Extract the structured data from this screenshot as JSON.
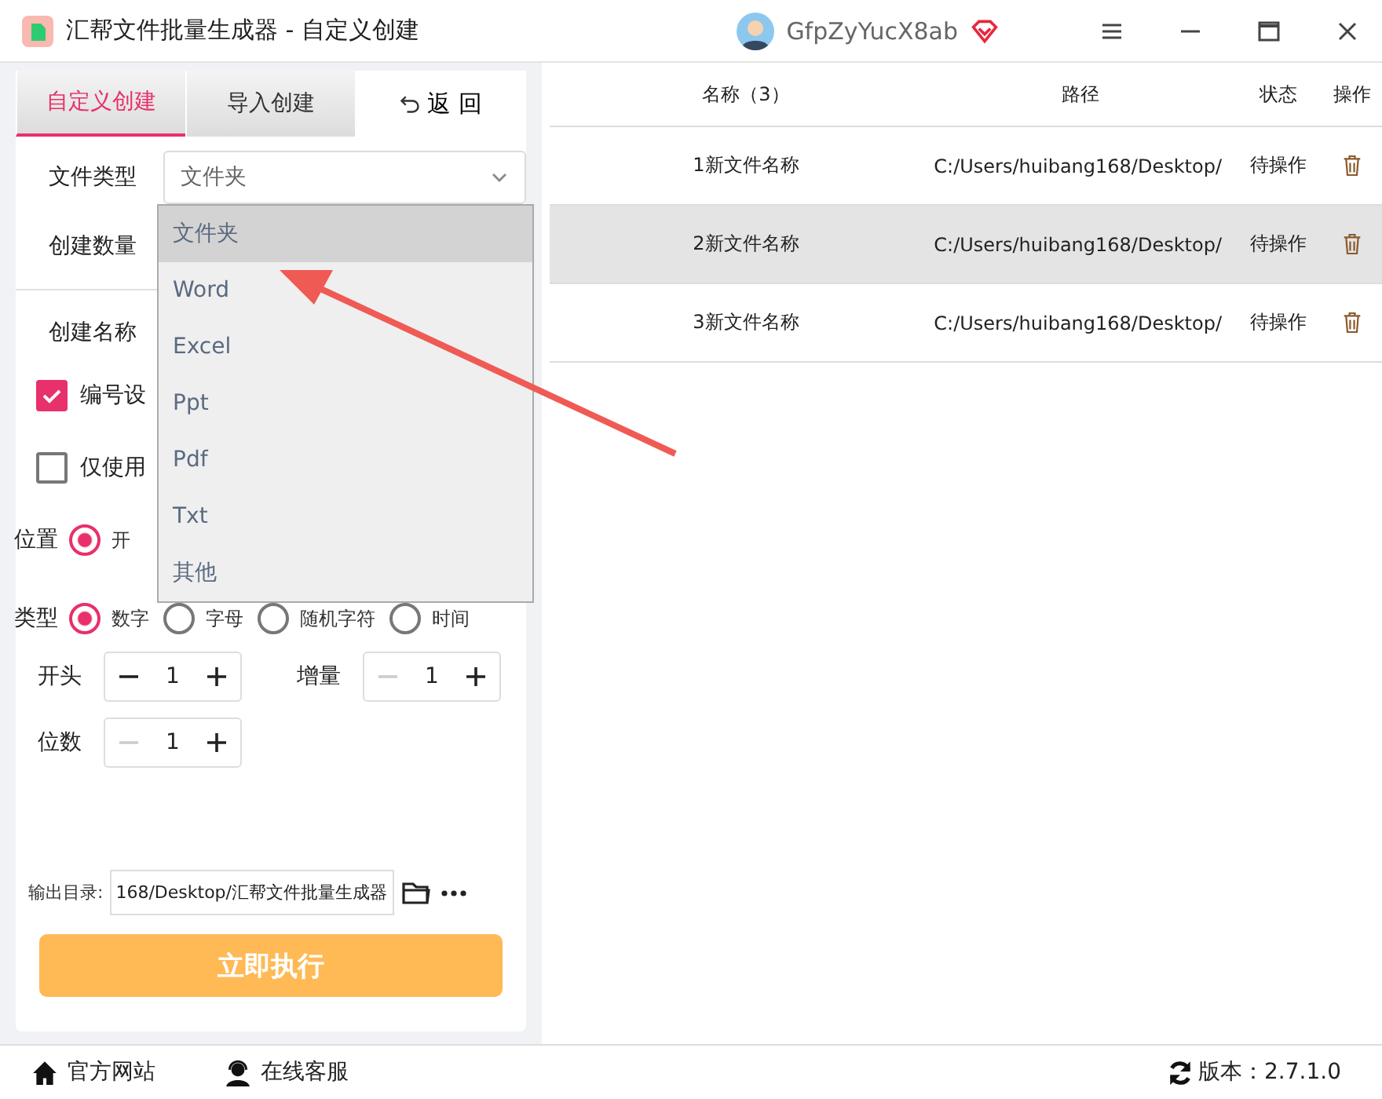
{
  "window": {
    "title": "汇帮文件批量生成器 - 自定义创建"
  },
  "user": {
    "name": "GfpZyYucX8ab"
  },
  "tabs": [
    {
      "label": "自定义创建",
      "selected": true
    },
    {
      "label": "导入创建",
      "selected": false
    }
  ],
  "back_button": "返 回",
  "form": {
    "file_type": {
      "label": "文件类型",
      "value": "文件夹"
    },
    "count_label": "创建数量",
    "name_label": "创建名称",
    "checkboxes": [
      {
        "label": "编号设",
        "checked": true
      },
      {
        "label": "仅使用",
        "checked": false
      }
    ],
    "radio_groups": [
      {
        "label": "位置",
        "options": [
          {
            "label": "开",
            "selected": true
          }
        ]
      },
      {
        "label": "类型",
        "options": [
          {
            "label": "数字",
            "selected": true
          },
          {
            "label": "字母",
            "selected": false
          },
          {
            "label": "随机字符",
            "selected": false
          },
          {
            "label": "时间",
            "selected": false
          }
        ]
      }
    ],
    "steppers": [
      {
        "label": "开头",
        "value": "1",
        "minus_disabled": false
      },
      {
        "label": "增量",
        "value": "1",
        "minus_disabled": true
      },
      {
        "label": "位数",
        "value": "1",
        "minus_disabled": true
      }
    ],
    "output": {
      "label": "输出目录:",
      "value": "168/Desktop/汇帮文件批量生成器"
    },
    "run_button": "立即执行"
  },
  "dropdown": {
    "options": [
      {
        "label": "文件夹",
        "selected": true
      },
      {
        "label": "Word",
        "selected": false
      },
      {
        "label": "Excel",
        "selected": false
      },
      {
        "label": "Ppt",
        "selected": false
      },
      {
        "label": "Pdf",
        "selected": false
      },
      {
        "label": "Txt",
        "selected": false
      },
      {
        "label": "其他",
        "selected": false
      }
    ]
  },
  "table": {
    "columns": [
      "名称（3）",
      "路径",
      "状态",
      "操作"
    ],
    "rows": [
      {
        "name": "1新文件名称",
        "path": "C:/Users/huibang168/Desktop/",
        "status": "待操作",
        "selected": false
      },
      {
        "name": "2新文件名称",
        "path": "C:/Users/huibang168/Desktop/",
        "status": "待操作",
        "selected": true
      },
      {
        "name": "3新文件名称",
        "path": "C:/Users/huibang168/Desktop/",
        "status": "待操作",
        "selected": false
      }
    ]
  },
  "footer": {
    "links": [
      "官方网站",
      "在线客服"
    ],
    "version": "版本：2.7.1.0"
  }
}
